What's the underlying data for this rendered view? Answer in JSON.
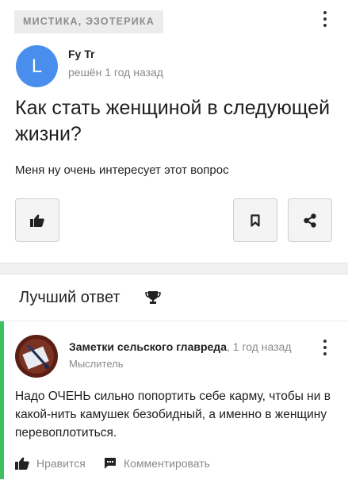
{
  "question": {
    "category": "МИСТИКА, ЭЗОТЕРИКА",
    "author": {
      "initial": "L",
      "name": "Fy Tr",
      "status": "решён 1 год назад"
    },
    "title": "Как стать женщиной в следующей жизни?",
    "body": "Меня ну очень интересует этот вопрос"
  },
  "best_answer": {
    "section_title": "Лучший ответ",
    "author": {
      "name": "Заметки сельского главреда",
      "time": ", 1 год назад",
      "rank": "Мыслитель"
    },
    "text": "Надо ОЧЕНЬ сильно попортить себе карму, чтобы ни в какой-нить камушек безобидный, а именно в женщину перевоплотиться.",
    "like_label": "Нравится",
    "comment_label": "Комментировать"
  },
  "colors": {
    "accent_green": "#3ec15f",
    "avatar_blue": "#4a8eed",
    "tag_bg": "#ececec",
    "button_bg": "#f4f4f4"
  },
  "icons": [
    "kebab-menu-icon",
    "thumbs-up-icon",
    "bookmark-icon",
    "share-icon",
    "trophy-icon",
    "comment-icon"
  ]
}
